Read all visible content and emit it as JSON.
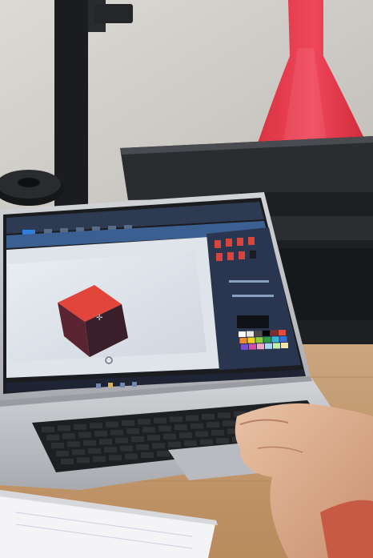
{
  "scene": {
    "description_kind": "photo",
    "objects": [
      "3d-printer",
      "printed-vase",
      "filament-spool",
      "laptop",
      "keyboard",
      "trackpad",
      "hand",
      "notebook",
      "wooden-desk"
    ]
  },
  "screen": {
    "app": "3d-paint-editor",
    "canvas": {
      "model": "cube",
      "top_color": "#e2463a",
      "side_color": "#3a1f2a",
      "front_color": "#5b2433"
    }
  },
  "palette": {
    "swatches": [
      "#ffffff",
      "#e8e8e8",
      "#4a4a4a",
      "#000000",
      "#7a2e2e",
      "#e24a3a",
      "#f08a2a",
      "#f2d21e",
      "#8fcf3a",
      "#2e9a4a",
      "#38b6d8",
      "#3a6fd8",
      "#7a4ad8",
      "#d84aa8",
      "#f2a6c2",
      "#a6d8f2",
      "#c2f2a6",
      "#f2e6a6"
    ]
  },
  "colors": {
    "vase": "#ef3f4f",
    "desk": "#c89868",
    "laptop_body": "#c6c8cc",
    "screen_bezel": "#1a1c20",
    "wall": "#d5d3ce"
  }
}
